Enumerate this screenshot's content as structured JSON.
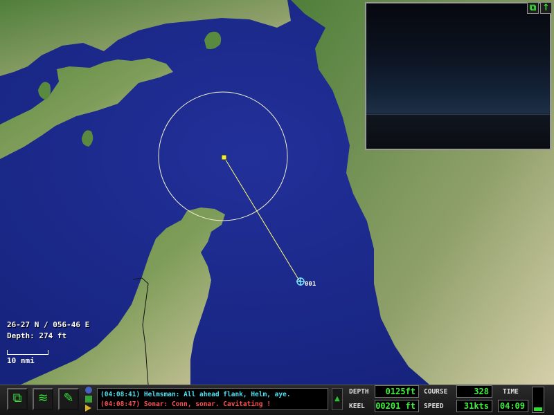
{
  "map": {
    "position": [
      "26-27 N / 056-46 E",
      "Depth: 274 ft"
    ],
    "scale_label": "10 nmi",
    "contact_label": "001"
  },
  "periscope": {
    "view_button": "view-toggle-icon",
    "expand_button": "arrow-up-icon"
  },
  "toolbar": {
    "buttons": [
      "map-window-icon",
      "sonar-wave-icon",
      "wrench-icon"
    ]
  },
  "log": {
    "messages": [
      "(04:08:41) Helmsman: All ahead flank, Helm, aye.",
      "(04:08:47) Sonar: Conn, sonar. Cavitating !"
    ]
  },
  "gauges": {
    "depth_label": "DEPTH",
    "depth_value": "0125ft",
    "keel_label": "KEEL",
    "keel_value": "00201 ft",
    "course_label": "COURSE",
    "course_value": "328",
    "speed_label": "SPEED",
    "speed_value": "31kts",
    "time_label": "TIME",
    "time_value": "04:09",
    "throttle_fraction": 0.15
  },
  "colors": {
    "ocean": "#1e2e90",
    "land": "#4e7e3a",
    "text_green": "#3cf03c",
    "log_cyan": "#4fe0f0",
    "log_red": "#ff5050"
  }
}
